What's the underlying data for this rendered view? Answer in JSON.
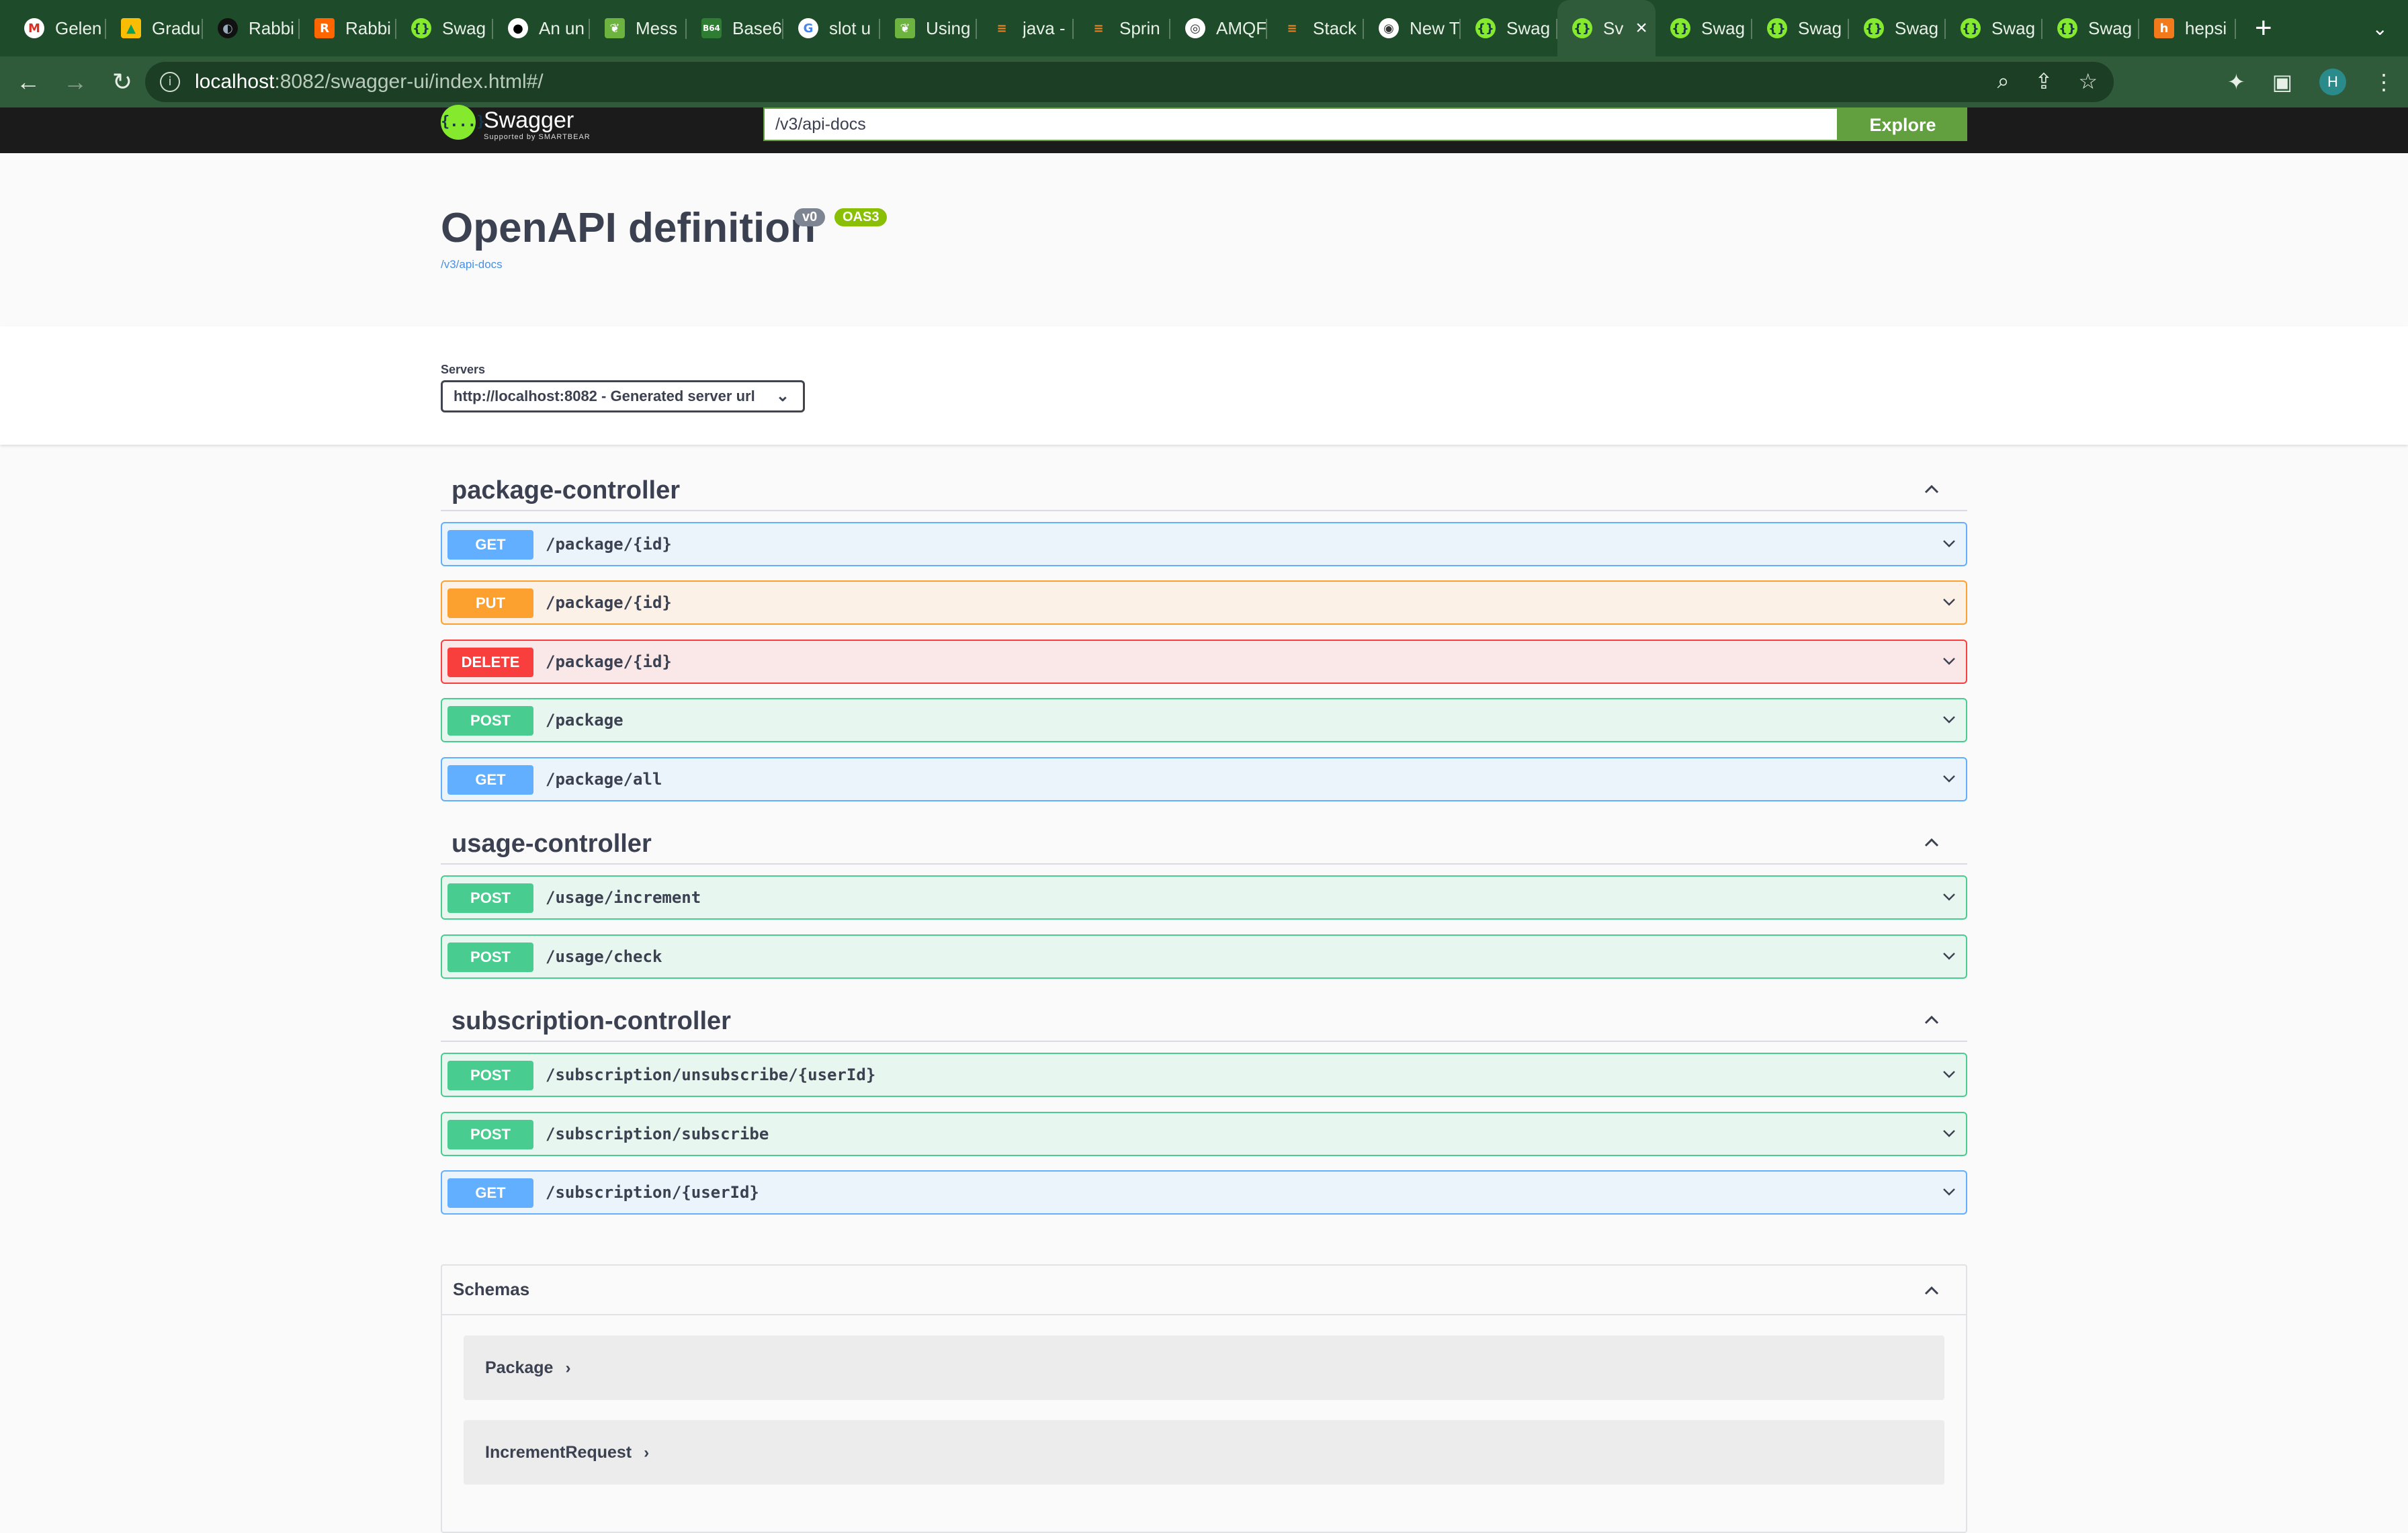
{
  "browser": {
    "tabs": [
      {
        "title": "Gelen",
        "icon": "gmail-icon",
        "glyph": "M",
        "style": "gm"
      },
      {
        "title": "Gradu",
        "icon": "google-drive-icon",
        "glyph": "▲",
        "style": "gd"
      },
      {
        "title": "Rabbi",
        "icon": "rabbit-icon",
        "glyph": "◐",
        "style": "dark"
      },
      {
        "title": "Rabbi",
        "icon": "rabbitmq-icon",
        "glyph": "R",
        "style": "rb"
      },
      {
        "title": "Swag",
        "icon": "swagger-icon",
        "glyph": "{}",
        "style": "swag"
      },
      {
        "title": "An un",
        "icon": "github-icon",
        "glyph": "●",
        "style": "gh"
      },
      {
        "title": "Mess",
        "icon": "spring-leaf-icon",
        "glyph": "❦",
        "style": "leaf"
      },
      {
        "title": "Base6",
        "icon": "base64-icon",
        "glyph": "B64",
        "style": "b64"
      },
      {
        "title": "slot u",
        "icon": "google-icon",
        "glyph": "G",
        "style": "g"
      },
      {
        "title": "Using",
        "icon": "spring-leaf-icon",
        "glyph": "❦",
        "style": "leaf"
      },
      {
        "title": "java -",
        "icon": "stackoverflow-icon",
        "glyph": "≡",
        "style": "so"
      },
      {
        "title": "Sprin",
        "icon": "stackoverflow-icon",
        "glyph": "≡",
        "style": "so"
      },
      {
        "title": "AMQF",
        "icon": "globe-icon",
        "glyph": "◎",
        "style": "globe"
      },
      {
        "title": "Stack",
        "icon": "stackoverflow-icon",
        "glyph": "≡",
        "style": "so"
      },
      {
        "title": "New T",
        "icon": "chrome-icon",
        "glyph": "◉",
        "style": "globe"
      },
      {
        "title": "Swag",
        "icon": "swagger-icon",
        "glyph": "{}",
        "style": "swag"
      },
      {
        "title": "Sv",
        "icon": "swagger-icon",
        "glyph": "{}",
        "style": "swag",
        "active": true
      },
      {
        "title": "Swag",
        "icon": "swagger-icon",
        "glyph": "{}",
        "style": "swag"
      },
      {
        "title": "Swag",
        "icon": "swagger-icon",
        "glyph": "{}",
        "style": "swag"
      },
      {
        "title": "Swag",
        "icon": "swagger-icon",
        "glyph": "{}",
        "style": "swag"
      },
      {
        "title": "Swag",
        "icon": "swagger-icon",
        "glyph": "{}",
        "style": "swag"
      },
      {
        "title": "Swag",
        "icon": "swagger-icon",
        "glyph": "{}",
        "style": "swag"
      },
      {
        "title": "hepsi",
        "icon": "hepsiburada-icon",
        "glyph": "h",
        "style": "hep"
      }
    ],
    "url_host": "localhost",
    "url_rest": ":8082/swagger-ui/index.html#/",
    "avatar_initial": "H"
  },
  "swagger": {
    "logo_name": "Swagger",
    "logo_sub": "Supported by SMARTBEAR",
    "logo_mark": "{...}",
    "spec_url": "/v3/api-docs",
    "explore_label": "Explore"
  },
  "info": {
    "title": "OpenAPI definition",
    "version": "v0",
    "oas": "OAS3",
    "link": "/v3/api-docs"
  },
  "servers": {
    "label": "Servers",
    "selected": "http://localhost:8082 - Generated server url"
  },
  "controllers": [
    {
      "name": "package-controller",
      "operations": [
        {
          "method": "GET",
          "path": "/package/{id}"
        },
        {
          "method": "PUT",
          "path": "/package/{id}"
        },
        {
          "method": "DELETE",
          "path": "/package/{id}"
        },
        {
          "method": "POST",
          "path": "/package"
        },
        {
          "method": "GET",
          "path": "/package/all"
        }
      ]
    },
    {
      "name": "usage-controller",
      "operations": [
        {
          "method": "POST",
          "path": "/usage/increment"
        },
        {
          "method": "POST",
          "path": "/usage/check"
        }
      ]
    },
    {
      "name": "subscription-controller",
      "operations": [
        {
          "method": "POST",
          "path": "/subscription/unsubscribe/{userId}"
        },
        {
          "method": "POST",
          "path": "/subscription/subscribe"
        },
        {
          "method": "GET",
          "path": "/subscription/{userId}"
        }
      ]
    }
  ],
  "schemas": {
    "title": "Schemas",
    "models": [
      "Package",
      "IncrementRequest"
    ]
  }
}
